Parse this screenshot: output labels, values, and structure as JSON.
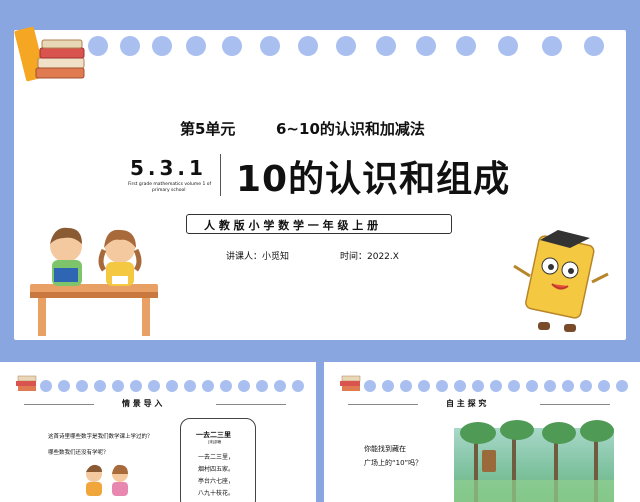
{
  "main_slide": {
    "unit_label": "第5单元",
    "unit_title": "6~10的认识和加减法",
    "lesson_number": "5.3.1",
    "lesson_title": "10的认识和组成",
    "english_caption_line1": "First grade mathematics volume 1 of",
    "english_caption_line2": "primary school",
    "textbook": "人 教 版 小 学 数 学 一 年 级 上 册",
    "lecturer": "讲课人：小觅知",
    "time": "时间：2022.X"
  },
  "thumb1": {
    "section_title": "情 景 导 入",
    "question_line1": "这首诗里哪些数字是我们数学课上学过的？",
    "question_line2": "哪些数我们还没有学呢？",
    "poem_title": "一去二三里",
    "poem_author": "[宋]邵雍",
    "poem_lines": [
      "一去二三里，",
      "烟村四五家。",
      "亭台六七座，",
      "八九十枝花。"
    ]
  },
  "thumb2": {
    "section_title": "自 主 探 究",
    "question_line1": "你能找到藏在",
    "question_line2": "广场上的“10”吗？"
  },
  "colors": {
    "background": "#8aa6e0",
    "hole": "#a9bff0",
    "accent_orange": "#f0a63a"
  }
}
